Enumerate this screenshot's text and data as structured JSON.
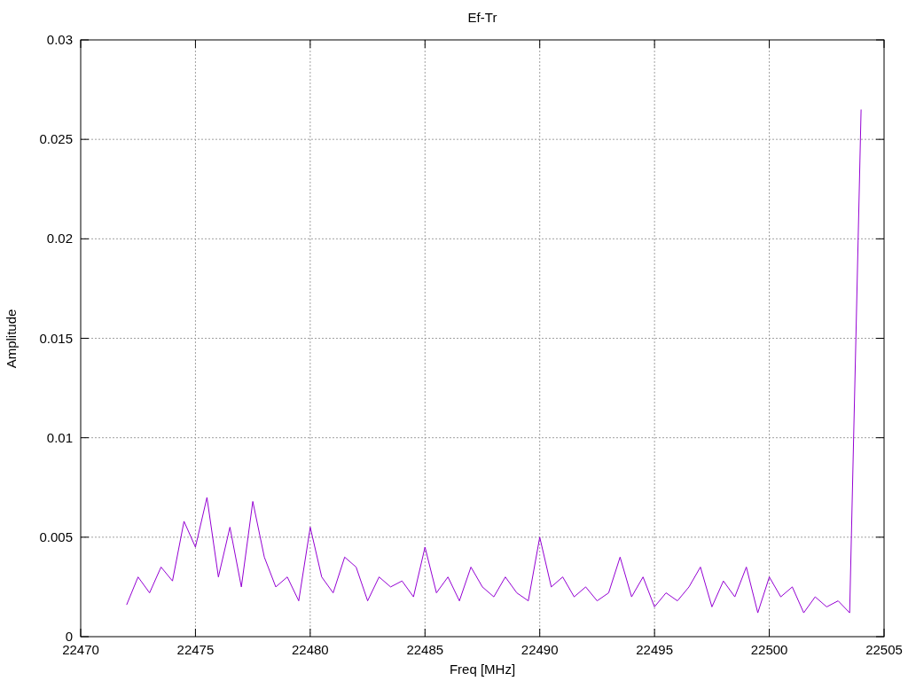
{
  "chart_data": {
    "type": "line",
    "title": "Ef-Tr",
    "xlabel": "Freq [MHz]",
    "ylabel": "Amplitude",
    "grid": true,
    "xlim": [
      22470,
      22505
    ],
    "ylim": [
      0,
      0.03
    ],
    "xticks": [
      22470,
      22475,
      22480,
      22485,
      22490,
      22495,
      22500,
      22505
    ],
    "yticks": [
      {
        "value": 0,
        "label": "0"
      },
      {
        "value": 0.005,
        "label": "0.005"
      },
      {
        "value": 0.01,
        "label": "0.01"
      },
      {
        "value": 0.015,
        "label": "0.015"
      },
      {
        "value": 0.02,
        "label": "0.02"
      },
      {
        "value": 0.025,
        "label": "0.025"
      },
      {
        "value": 0.03,
        "label": "0.03"
      }
    ],
    "x": [
      22472,
      22472.5,
      22473,
      22473.5,
      22474,
      22474.5,
      22475,
      22475.5,
      22476,
      22476.5,
      22477,
      22477.5,
      22478,
      22478.5,
      22479,
      22479.5,
      22480,
      22480.5,
      22481,
      22481.5,
      22482,
      22482.5,
      22483,
      22483.5,
      22484,
      22484.5,
      22485,
      22485.5,
      22486,
      22486.5,
      22487,
      22487.5,
      22488,
      22488.5,
      22489,
      22489.5,
      22490,
      22490.5,
      22491,
      22491.5,
      22492,
      22492.5,
      22493,
      22493.5,
      22494,
      22494.5,
      22495,
      22495.5,
      22496,
      22496.5,
      22497,
      22497.5,
      22498,
      22498.5,
      22499,
      22499.5,
      22500,
      22500.5,
      22501,
      22501.5,
      22502,
      22502.5,
      22503,
      22503.5,
      22504
    ],
    "series": [
      {
        "color": "#9400d3",
        "values": [
          0.0016,
          0.003,
          0.0022,
          0.0035,
          0.0028,
          0.0058,
          0.0045,
          0.007,
          0.003,
          0.0055,
          0.0025,
          0.0068,
          0.004,
          0.0025,
          0.003,
          0.0018,
          0.0055,
          0.003,
          0.0022,
          0.004,
          0.0035,
          0.0018,
          0.003,
          0.0025,
          0.0028,
          0.002,
          0.0045,
          0.0022,
          0.003,
          0.0018,
          0.0035,
          0.0025,
          0.002,
          0.003,
          0.0022,
          0.0018,
          0.005,
          0.0025,
          0.003,
          0.002,
          0.0025,
          0.0018,
          0.0022,
          0.004,
          0.002,
          0.003,
          0.0015,
          0.0022,
          0.0018,
          0.0025,
          0.0035,
          0.0015,
          0.0028,
          0.002,
          0.0035,
          0.0012,
          0.003,
          0.002,
          0.0025,
          0.0012,
          0.002,
          0.0015,
          0.0018,
          0.0012,
          0.0265
        ]
      }
    ]
  }
}
